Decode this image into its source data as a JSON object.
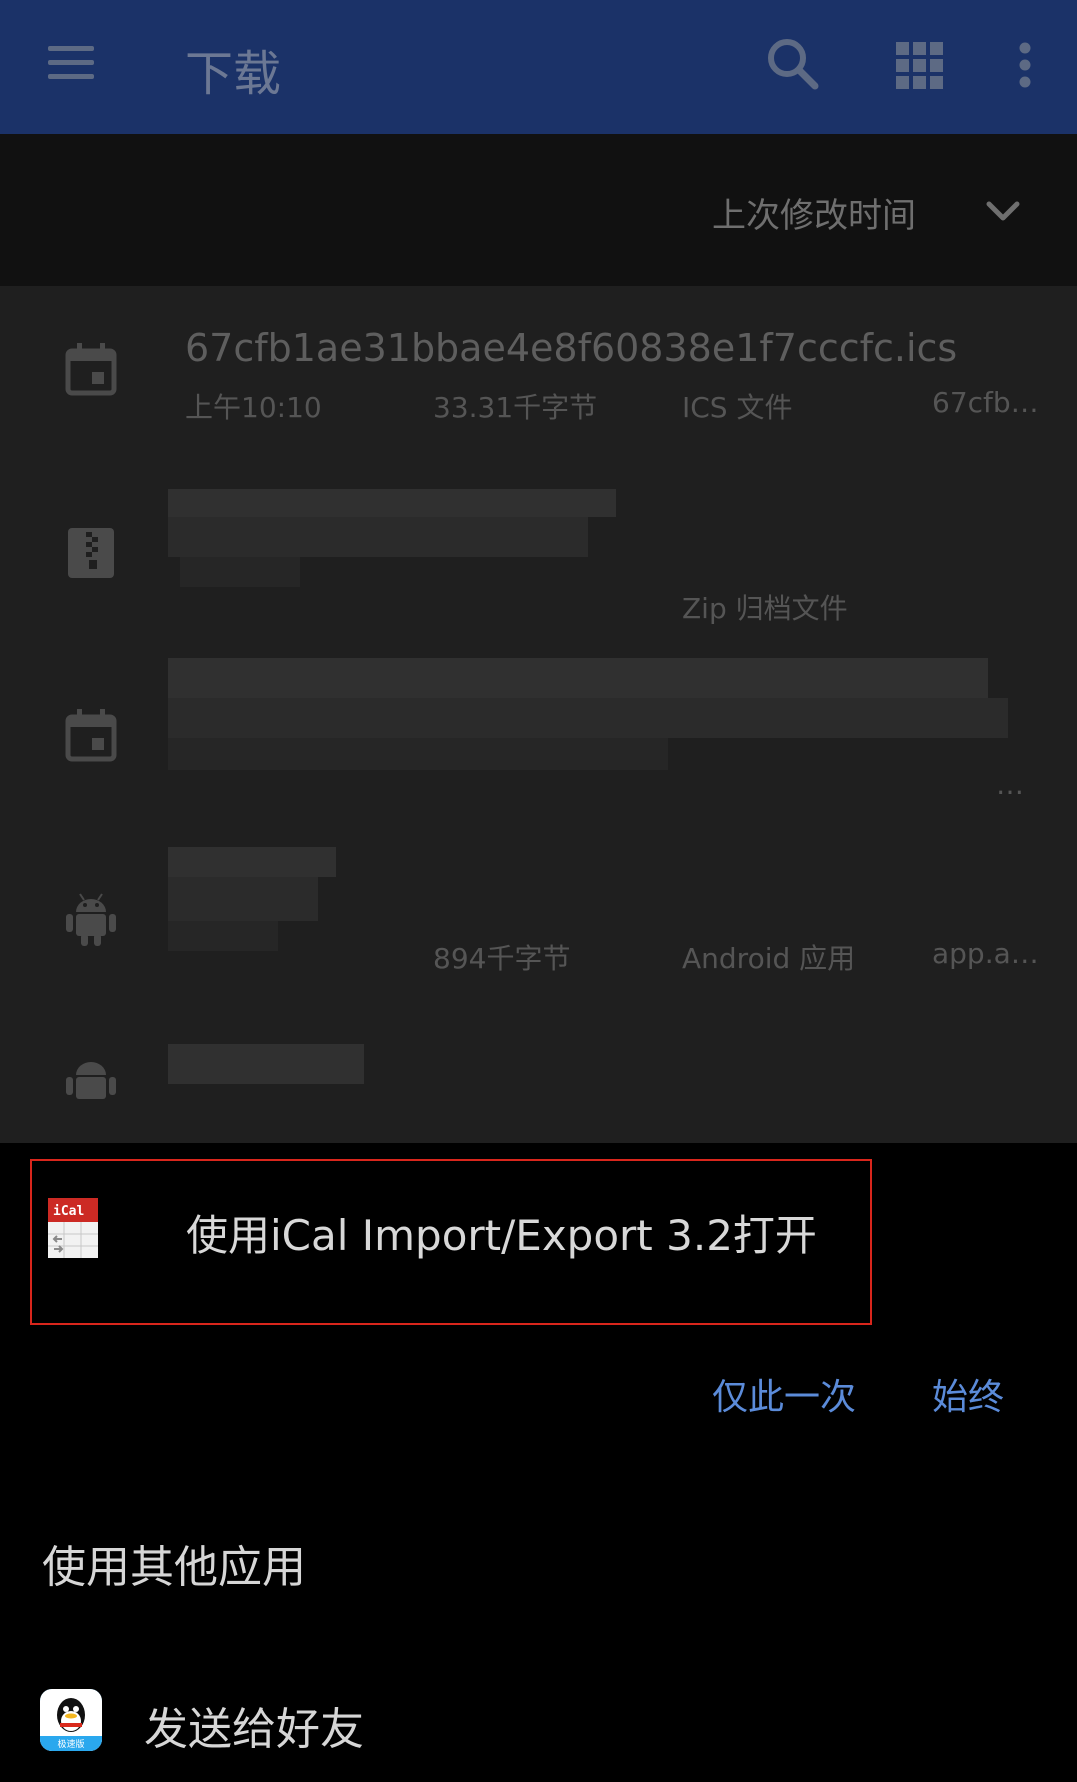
{
  "appbar": {
    "title": "下载",
    "icons": [
      "menu-icon",
      "search-icon",
      "grid-view-icon",
      "more-vert-icon"
    ],
    "color": "#1b3268"
  },
  "sortbar": {
    "label": "上次修改时间",
    "icon": "chevron-down-icon"
  },
  "files": [
    {
      "icon": "calendar-icon",
      "name": "67cfb1ae31bbae4e8f60838e1f7cccfc.ics",
      "time": "上午10:10",
      "size": "33.31千字节",
      "type": "ICS 文件",
      "path": "67cfb…"
    },
    {
      "icon": "zip-icon",
      "name": "",
      "time": "",
      "size": "",
      "type": "Zip 归档文件",
      "path": ""
    },
    {
      "icon": "calendar-icon",
      "name": "",
      "time": "",
      "size": "",
      "type": "",
      "path": "…"
    },
    {
      "icon": "android-icon",
      "name": "",
      "time": "",
      "size": "894千字节",
      "type": "Android 应用",
      "path": "app.a…"
    },
    {
      "icon": "android-icon",
      "name": "",
      "time": "",
      "size": "",
      "type": "",
      "path": ""
    }
  ],
  "sheet": {
    "open_with": {
      "label": "使用iCal Import/Export 3.2打开",
      "icon_text": "iCal",
      "highlight_color": "#d9261c"
    },
    "btn_once": "仅此一次",
    "btn_always": "始终",
    "other_apps": "使用其他应用",
    "share": {
      "label": "发送给好友",
      "icon_badge": "极速版"
    },
    "accent": "#5b8bd9"
  }
}
